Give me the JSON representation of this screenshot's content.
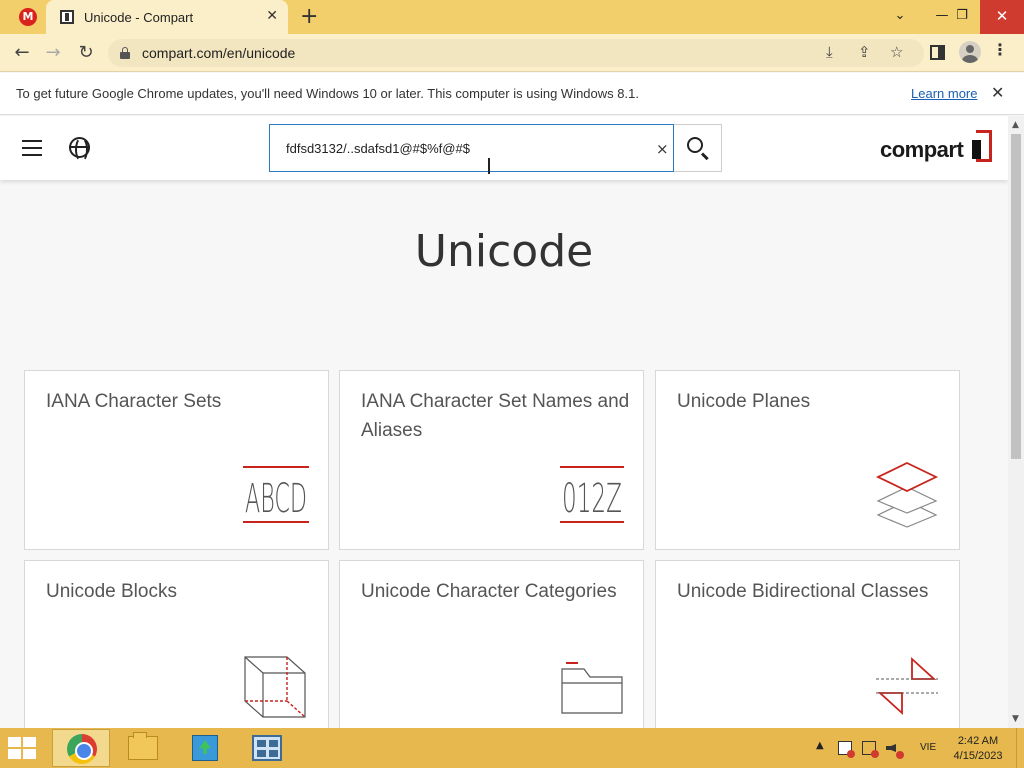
{
  "browser": {
    "tab": {
      "title": "Unicode - Compart",
      "close_glyph": "✕"
    },
    "pinned_tab_glyph": "M",
    "new_tab_glyph": "+",
    "window_controls": {
      "tab_search": "⌄",
      "minimize": "—",
      "restore": "❐",
      "close": "✕"
    },
    "nav": {
      "back": "←",
      "forward": "→",
      "reload": "↻"
    },
    "url": "compart.com/en/unicode",
    "omnibox_icons": {
      "install": "⤓",
      "share": "⇪",
      "bookmark": "☆"
    },
    "menu_glyph": "⋮"
  },
  "infobar": {
    "message": "To get future Google Chrome updates, you'll need Windows 10 or later. This computer is using Windows 8.1.",
    "link": "Learn more",
    "close_glyph": "✕"
  },
  "header": {
    "search_value": "fdfsd3132/..sdafsd1@#$%f@#$",
    "clear_glyph": "×",
    "logo_text": "compart"
  },
  "page": {
    "title": "Unicode",
    "cards": [
      {
        "title": "IANA Character Sets",
        "art_text": "ABCD"
      },
      {
        "title": "IANA Character Set Names and Aliases",
        "art_text": "012Z"
      },
      {
        "title": "Unicode Planes"
      },
      {
        "title": "Unicode Blocks"
      },
      {
        "title": "Unicode Character Categories"
      },
      {
        "title": "Unicode Bidirectional Classes"
      }
    ],
    "accent_color": "#c8231d"
  },
  "scrollbar": {
    "up": "▲",
    "down": "▼"
  },
  "taskbar": {
    "tray_up": "▲",
    "language": "VIE",
    "time": "2:42 AM",
    "date": "4/15/2023",
    "color": "#e7b84d"
  }
}
